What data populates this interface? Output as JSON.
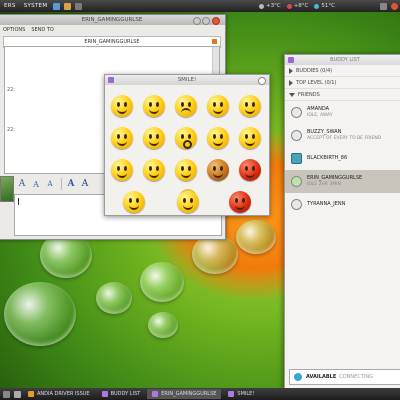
{
  "top_panel": {
    "menus": [
      "ERS",
      "SYSTEM"
    ],
    "weather": "+3°C",
    "temp1": "+8°C",
    "temp2": "51°C"
  },
  "chat_window": {
    "title": "ERIN_GAMINGGURLSE",
    "menus": [
      "OPTIONS",
      "SEND TO"
    ],
    "conversation_title": "ERIN_GAMINGGURLSE",
    "lines": [
      "22:",
      "22:"
    ]
  },
  "smiley_popup": {
    "title": "SMILE!"
  },
  "buddy_list": {
    "title": "BUDDY LIST",
    "groups": {
      "buddies": "BUDDIES (0/4)",
      "top_level": "TOP LEVEL (0/1)",
      "friends": "FRIENDS"
    },
    "buddies": [
      {
        "name": "AMANDA",
        "status": "IDLE, AWAY"
      },
      {
        "name": "BUZZY_SWAN",
        "status": "ACCEPT OF EVERY TO BE FRIEND"
      },
      {
        "name": "BLACKBIRTH_86",
        "status": ""
      },
      {
        "name": "ERIN_GAMINGGURLSE",
        "status": "IDLE 2HR 3MIN"
      },
      {
        "name": "TYRANNA_JENN",
        "status": ""
      }
    ],
    "status": "AVAILABLE",
    "status_sub": "CONNECTING"
  },
  "taskbar": {
    "items": [
      "ANDIA DRIVER ISSUE",
      "BUDDY LIST",
      "ERIN_GAMINGGURLSE",
      "SMILE!"
    ]
  }
}
